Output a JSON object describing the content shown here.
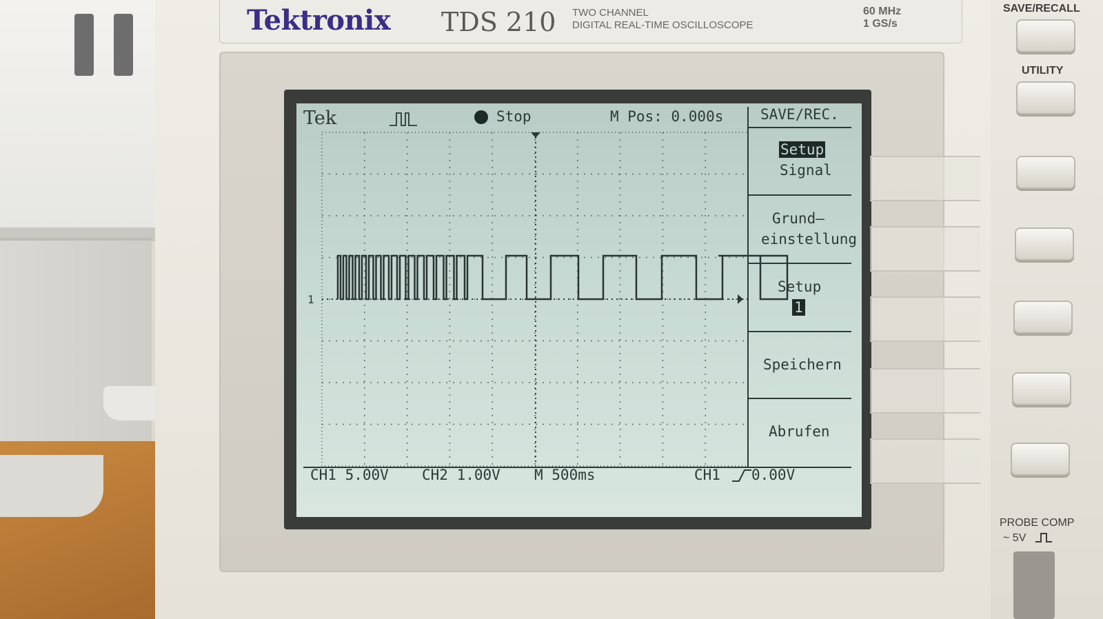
{
  "brand": {
    "name": "Tektronix",
    "model": "TDS 210",
    "subtitle_1": "TWO CHANNEL",
    "subtitle_2": "DIGITAL REAL-TIME OSCILLOSCOPE",
    "spec_1": "60 MHz",
    "spec_2": "1 GS/s"
  },
  "screen": {
    "logo": "Tek",
    "status": "Stop",
    "m_pos": "M Pos: 0.000s",
    "menu_title": "SAVE/REC.",
    "menu": [
      {
        "line1": "Setup",
        "line2": "Signal"
      },
      {
        "line1": "Grund–",
        "line2": "einstellung"
      },
      {
        "line1": "Setup",
        "line2": "1"
      },
      {
        "line1": "Speichern",
        "line2": ""
      },
      {
        "line1": "Abrufen",
        "line2": ""
      }
    ],
    "ch1_scale": "CH1 5.00V",
    "ch2_scale": "CH2 1.00V",
    "timebase": "M 500ms",
    "trigger": "CH1",
    "trigger_level": "0.00V",
    "channel_marker": "1"
  },
  "panel": {
    "save_recall_label": "SAVE/RECALL",
    "utility_label": "UTILITY",
    "probe_comp_label": "PROBE COMP",
    "probe_comp_value": "~ 5V"
  },
  "colors": {
    "brand": "#3a2e86",
    "lcd": "#c8dad4",
    "lcd_ink": "#2d3a38"
  }
}
